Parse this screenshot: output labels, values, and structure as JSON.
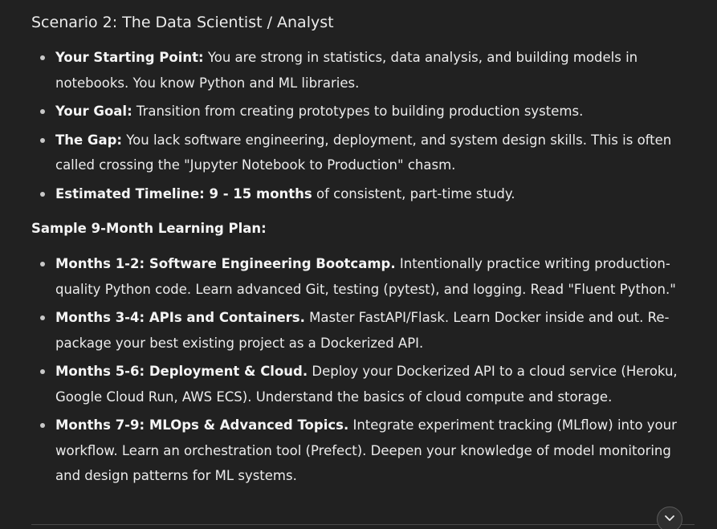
{
  "heading": "Scenario 2: The Data Scientist / Analyst",
  "scenario_items": [
    {
      "label": "Your Starting Point:",
      "text": " You are strong in statistics, data analysis, and building models in notebooks. You know Python and ML libraries."
    },
    {
      "label": "Your Goal:",
      "text": " Transition from creating prototypes to building production systems."
    },
    {
      "label": "The Gap:",
      "text": " You lack software engineering, deployment, and system design skills. This is often called crossing the \"Jupyter Notebook to Production\" chasm."
    },
    {
      "label": "Estimated Timeline: 9 - 15 months",
      "text": " of consistent, part-time study."
    }
  ],
  "plan_heading": "Sample 9-Month Learning Plan:",
  "plan_items": [
    {
      "label": "Months 1-2: Software Engineering Bootcamp.",
      "text": " Intentionally practice writing production-quality Python code. Learn advanced Git, testing (pytest), and logging. Read \"Fluent Python.\""
    },
    {
      "label": "Months 3-4: APIs and Containers.",
      "text": " Master FastAPI/Flask. Learn Docker inside and out. Re-package your best existing project as a Dockerized API."
    },
    {
      "label": "Months 5-6: Deployment & Cloud.",
      "text": " Deploy your Dockerized API to a cloud service (Heroku, Google Cloud Run, AWS ECS). Understand the basics of cloud compute and storage."
    },
    {
      "label": "Months 7-9: MLOps & Advanced Topics.",
      "text": " Integrate experiment tracking (MLflow) into your workflow. Learn an orchestration tool (Prefect). Deepen your knowledge of model monitoring and design patterns for ML systems."
    }
  ],
  "scroll_button": {
    "icon": "chevron-down-icon"
  },
  "colors": {
    "background": "#212121",
    "text": "#ececec"
  }
}
